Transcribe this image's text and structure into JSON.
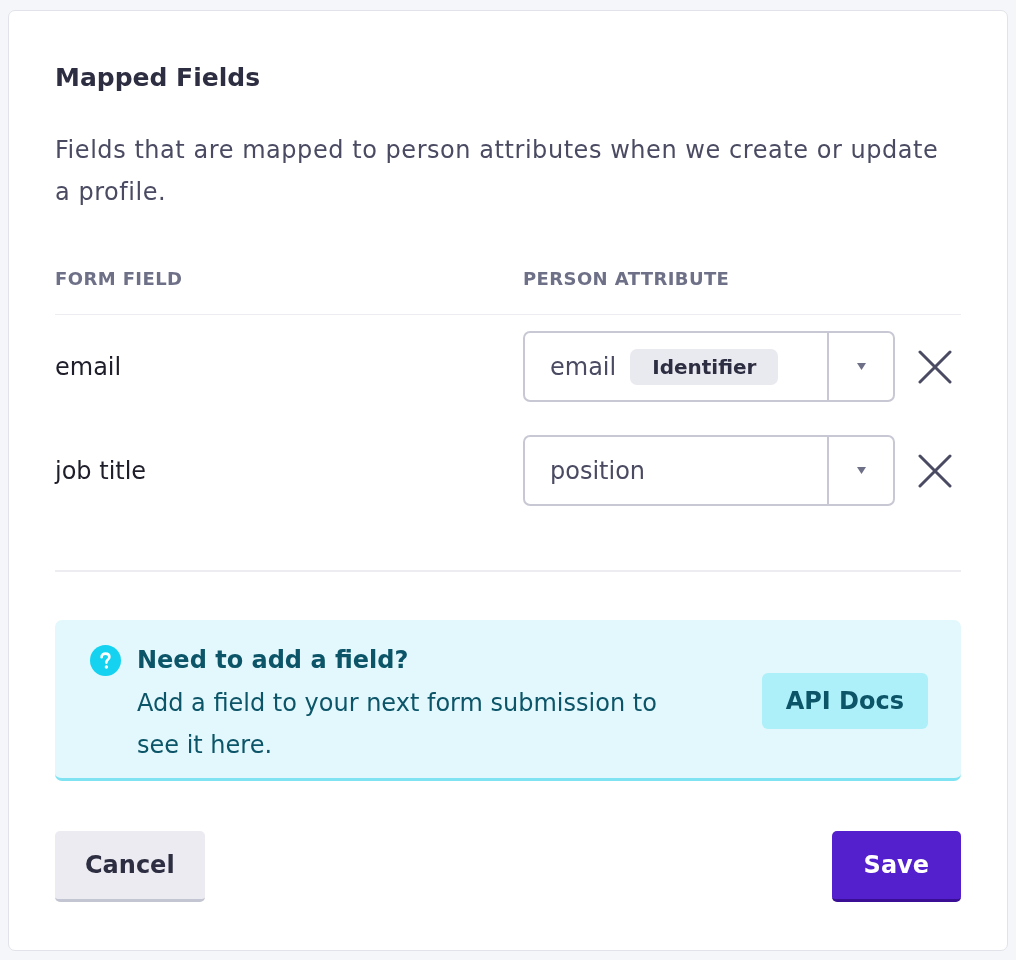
{
  "dialog": {
    "title": "Mapped Fields",
    "description": "Fields that are mapped to person attributes when we create or update a profile."
  },
  "table": {
    "columns": [
      "FORM FIELD",
      "PERSON ATTRIBUTE"
    ],
    "rows": [
      {
        "form_field": "email",
        "attribute": {
          "value": "email",
          "badge": "Identifier"
        }
      },
      {
        "form_field": "job title",
        "attribute": {
          "value": "position"
        }
      }
    ]
  },
  "callout": {
    "title": "Need to add a field?",
    "text": "Add a field to your next form submission to see it here.",
    "button": "API Docs"
  },
  "buttons": [
    {
      "label": "Cancel",
      "kind": "secondary"
    },
    {
      "label": "Save",
      "kind": "primary"
    }
  ]
}
